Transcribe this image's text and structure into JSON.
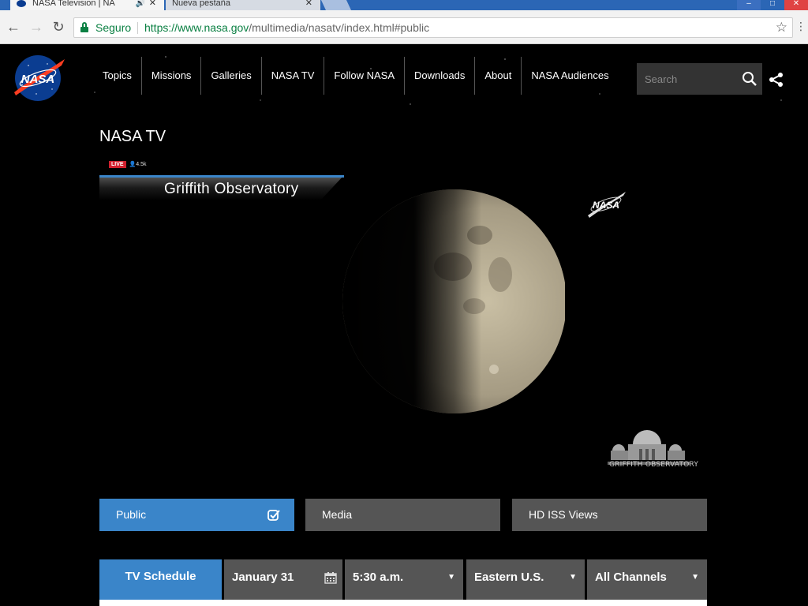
{
  "browser": {
    "tabs": [
      {
        "title": "NASA Television | NA",
        "active": true
      },
      {
        "title": "Nueva pestaña",
        "active": false
      }
    ],
    "security_label": "Seguro",
    "url_host": "https://www.nasa.gov",
    "url_path": "/multimedia/nasatv/index.html#public"
  },
  "header": {
    "nav": [
      "Topics",
      "Missions",
      "Galleries",
      "NASA TV",
      "Follow NASA",
      "Downloads",
      "About",
      "NASA Audiences"
    ],
    "search_placeholder": "Search"
  },
  "page": {
    "title": "NASA TV"
  },
  "video": {
    "live_label": "LIVE",
    "viewers": "4.5k",
    "banner_title": "Griffith Observatory",
    "logo_text": "GRIFFITH OBSERVATORY"
  },
  "channels": [
    {
      "label": "Public",
      "selected": true
    },
    {
      "label": "Media",
      "selected": false
    },
    {
      "label": "HD ISS Views",
      "selected": false
    }
  ],
  "schedule": {
    "title": "TV Schedule",
    "date": "January 31",
    "time": "5:30 a.m.",
    "timezone": "Eastern U.S.",
    "channel_filter": "All Channels"
  },
  "colors": {
    "accent": "#3a85c9",
    "live": "#d0202e",
    "secure_green": "#0b8043",
    "inactive_tab": "#555555"
  }
}
